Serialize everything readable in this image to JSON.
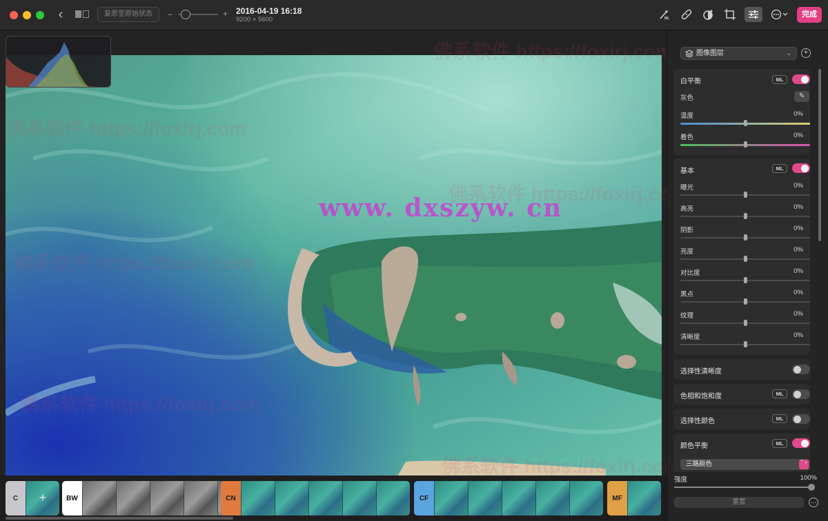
{
  "toolbar": {
    "revert_label": "复原至原始状态",
    "zoom_minus": "–",
    "zoom_plus": "+",
    "zoom_level": 0.15,
    "photo_date": "2016-04-19 16:18",
    "photo_dimensions": "9200 × 5600",
    "done_label": "完成",
    "icons": [
      "ml-magic-wand-icon",
      "bandage-retouch-icon",
      "effects-icon",
      "crop-icon",
      "adjust-sliders-icon",
      "more-options-icon"
    ]
  },
  "watermarks": {
    "main": "www. dxszyw. cn",
    "faint": [
      "佛系软件 https://foxirj.com",
      "佛系软件 https://foxirj.com",
      "佛系软件 https://foxirj.com",
      "佛系软件 https://foxirj.com",
      "佛系软件 https://foxirj.com",
      "佛系软件 https://foxirj.com"
    ]
  },
  "presets": [
    {
      "tab": "C",
      "color": "#c8c5cc",
      "text_color": "#2a2a2a",
      "thumbs": 1,
      "type": "color",
      "add": "+"
    },
    {
      "tab": "BW",
      "color": "#ffffff",
      "text_color": "#111111",
      "thumbs": 5,
      "type": "bw"
    },
    {
      "tab": "CN",
      "color": "#e07a3e",
      "text_color": "#1a1a1a",
      "thumbs": 5,
      "type": "color"
    },
    {
      "tab": "CF",
      "color": "#5aa4e0",
      "text_color": "#1a1a1a",
      "thumbs": 5,
      "type": "color"
    },
    {
      "tab": "MF",
      "color": "#e0a046",
      "text_color": "#1a1a1a",
      "thumbs": 1,
      "type": "color"
    }
  ],
  "panel": {
    "layer_select": "图像图层",
    "add_layer": "+",
    "white_balance": {
      "title": "白平衡",
      "ml": "ML",
      "enabled": true,
      "gray_label": "灰色",
      "eyedropper": "✎",
      "temperature": {
        "label": "温度",
        "value": "0%",
        "level": 0.5
      },
      "tint": {
        "label": "着色",
        "value": "0%",
        "level": 0.5
      }
    },
    "basic": {
      "title": "基本",
      "ml": "ML",
      "enabled": true,
      "rows": [
        {
          "label": "曝光",
          "value": "0%",
          "level": 0.5
        },
        {
          "label": "高亮",
          "value": "0%",
          "level": 0.5
        },
        {
          "label": "阴影",
          "value": "0%",
          "level": 0.5
        },
        {
          "label": "亮度",
          "value": "0%",
          "level": 0.5
        },
        {
          "label": "对比度",
          "value": "0%",
          "level": 0.5
        },
        {
          "label": "黑点",
          "value": "0%",
          "level": 0.5
        },
        {
          "label": "纹理",
          "value": "0%",
          "level": 0.5
        },
        {
          "label": "清晰度",
          "value": "0%",
          "level": 0.5
        }
      ]
    },
    "selective_definition": {
      "title": "选择性清晰度",
      "enabled": false
    },
    "hue_saturation": {
      "title": "色相和饱和度",
      "ml": "ML",
      "enabled": false
    },
    "selective_color": {
      "title": "选择性颜色",
      "ml": "ML",
      "enabled": false
    },
    "color_balance": {
      "title": "颜色平衡",
      "ml": "ML",
      "enabled": true,
      "method": "三路颜色",
      "method_arrows": "⌃⌄"
    },
    "strength": {
      "label": "强度",
      "value": "100%",
      "level": 1.0
    },
    "reset_label": "重置",
    "more": "…"
  },
  "colors": {
    "accent": "#e04a8a",
    "toolbar_bg": "#2a2a2b",
    "panel_bg": "#242425",
    "section_bg": "#2d2d2e"
  }
}
